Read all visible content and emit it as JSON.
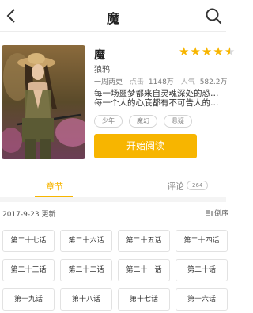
{
  "header": {
    "title": "魔"
  },
  "book": {
    "title": "魔",
    "author": "狼鸦",
    "rating_stars": 4.5,
    "status": "一周两更",
    "clicks_label": "点击",
    "clicks_value": "1148万",
    "popularity_label": "人气",
    "popularity_value": "582.2万",
    "description_line1": "每一场噩梦都来自灵魂深处的恐惧，",
    "description_line2": "每一个人的心底都有不可告人的过...",
    "tags": [
      "少年",
      "魔幻",
      "悬疑"
    ],
    "read_button": "开始阅读"
  },
  "tabs": {
    "chapters": "章节",
    "comments": "评论",
    "comments_count": "264"
  },
  "update": {
    "date": "2017-9-23 更新",
    "sort_label": "倒序"
  },
  "chapters": [
    "第二十七话",
    "第二十六话",
    "第二十五话",
    "第二十四话",
    "第二十三话",
    "第二十二话",
    "第二十一话",
    "第二十话",
    "第十九话",
    "第十八话",
    "第十七话",
    "第十六话"
  ],
  "colors": {
    "accent": "#f7b500"
  }
}
